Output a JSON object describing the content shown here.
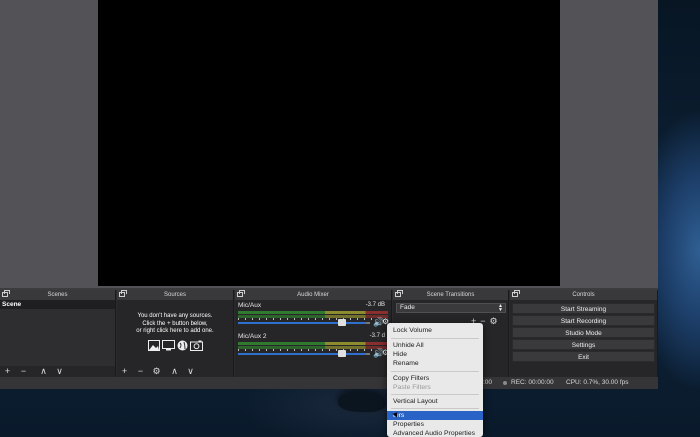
{
  "docks": {
    "scenes": {
      "title": "Scenes",
      "items": [
        "Scene"
      ],
      "toolbar": [
        "+",
        "−",
        "∧",
        "∨"
      ]
    },
    "sources": {
      "title": "Sources",
      "empty_line1": "You don't have any sources.",
      "empty_line2": "Click the + button below,",
      "empty_line3": "or right click here to add one.",
      "icons": [
        "image-icon",
        "monitor-icon",
        "globe-icon",
        "camera-icon"
      ],
      "toolbar": [
        "+",
        "−",
        "⚙",
        "∧",
        "∨"
      ]
    },
    "audio_mixer": {
      "title": "Audio Mixer",
      "channels": [
        {
          "name": "Mic/Aux",
          "db": "-3.7 dB",
          "level": 0.8
        },
        {
          "name": "Mic/Aux 2",
          "db": "-3.7 d",
          "level": 0.8
        }
      ]
    },
    "scene_transitions": {
      "title": "Scene Transitions",
      "selected": "Fade",
      "tools": [
        "+",
        "−",
        "⚙"
      ]
    },
    "controls": {
      "title": "Controls",
      "buttons": [
        "Start Streaming",
        "Start Recording",
        "Studio Mode",
        "Settings",
        "Exit"
      ]
    }
  },
  "status": {
    "live": ":00",
    "rec": "REC: 00:00:00",
    "cpu": "CPU: 0.7%, 30.00 fps"
  },
  "context_menu": {
    "items": [
      {
        "label": "Lock Volume",
        "state": "normal"
      },
      {
        "label": "Unhide All",
        "state": "normal"
      },
      {
        "label": "Hide",
        "state": "normal"
      },
      {
        "label": "Rename",
        "state": "normal"
      },
      {
        "label": "Copy Filters",
        "state": "normal"
      },
      {
        "label": "Paste Filters",
        "state": "disabled"
      },
      {
        "label": "Vertical Layout",
        "state": "normal"
      },
      {
        "label": "ters",
        "state": "highlighted"
      },
      {
        "label": "Properties",
        "state": "normal"
      },
      {
        "label": "Advanced Audio Properties",
        "state": "normal"
      }
    ]
  }
}
